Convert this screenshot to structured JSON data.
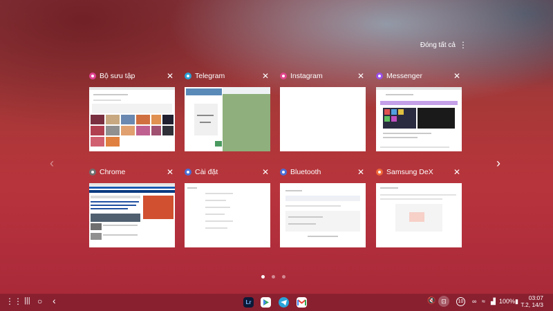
{
  "header": {
    "close_all_label": "Đóng tất cả",
    "more_icon": "more-vert-icon"
  },
  "recent_apps": [
    {
      "name": "Bộ sưu tập",
      "color": "#e04090"
    },
    {
      "name": "Telegram",
      "color": "#2aa3d8"
    },
    {
      "name": "Instagram",
      "color": "#e0458a"
    },
    {
      "name": "Messenger",
      "color": "#9b50e8"
    },
    {
      "name": "Chrome",
      "color": "#707070"
    },
    {
      "name": "Cài đặt",
      "color": "#4a6fd6"
    },
    {
      "name": "Bluetooth",
      "color": "#4a6fd6"
    },
    {
      "name": "Samsung DeX",
      "color": "#f06a3a"
    }
  ],
  "pager": {
    "pages": 3,
    "active": 1
  },
  "taskbar": {
    "dock_apps": [
      "Lr",
      "Play Store",
      "Telegram",
      "Gmail"
    ],
    "battery": "100%",
    "notification_count": "10",
    "time": "03:07",
    "date": "T.2, 14/3"
  }
}
